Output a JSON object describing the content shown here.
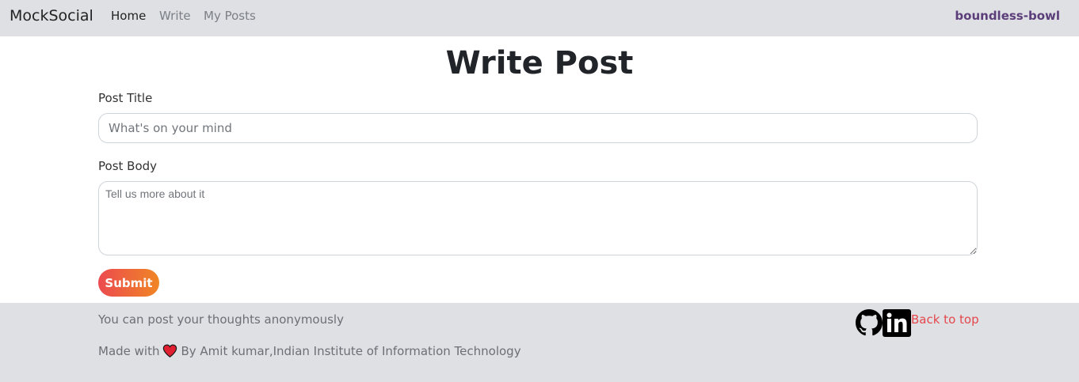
{
  "navbar": {
    "brand": "MockSocial",
    "links": [
      {
        "label": "Home",
        "active": true
      },
      {
        "label": "Write",
        "active": false
      },
      {
        "label": "My Posts",
        "active": false
      }
    ],
    "username": "boundless-bowl"
  },
  "main": {
    "title": "Write Post",
    "post_title": {
      "label": "Post Title",
      "value": "",
      "placeholder": "What's on your mind"
    },
    "post_body": {
      "label": "Post Body",
      "value": "",
      "placeholder": "Tell us more about it"
    },
    "submit_label": "Submit"
  },
  "footer": {
    "tagline": "You can post your thoughts anonymously",
    "made_with": "Made with",
    "credit": "By Amit kumar,Indian Institute of Information Technology",
    "back_to_top": "Back to top",
    "icons": [
      "github-icon",
      "linkedin-icon",
      "heart-icon"
    ]
  },
  "colors": {
    "nav_bg": "#dee0e4",
    "username": "#5b3d7a",
    "submit_gradient_start": "#ec4a50",
    "submit_gradient_end": "#f08624",
    "link_red": "#e4474c"
  }
}
